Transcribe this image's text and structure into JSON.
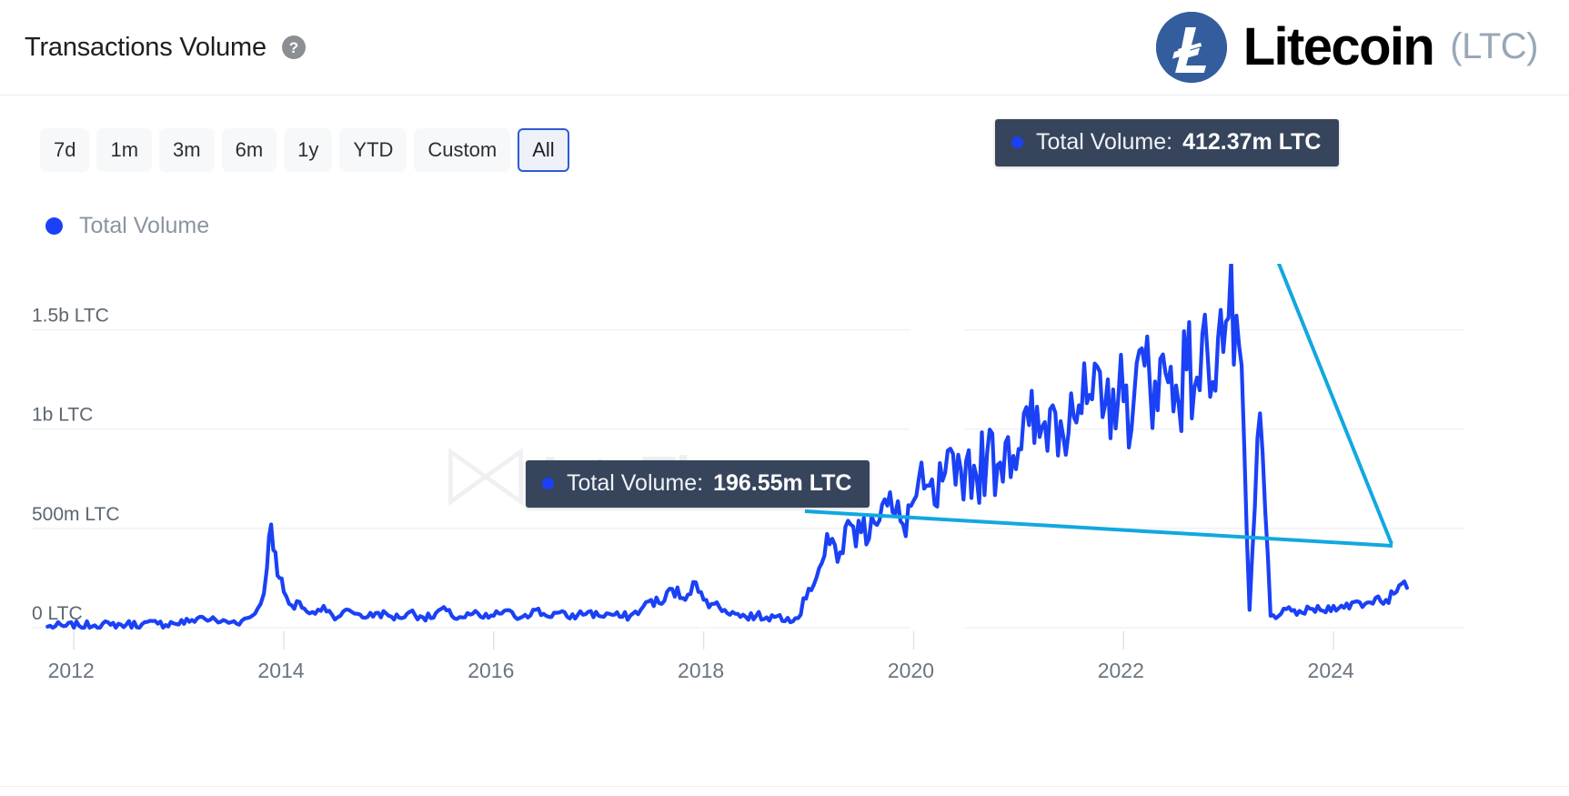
{
  "header": {
    "panel_title": "Transactions Volume",
    "help_icon": "question-mark-circle-icon",
    "coin_name": "Litecoin",
    "coin_ticker": "(LTC)",
    "coin_symbol": "Ł",
    "logo_color": "#345D9D"
  },
  "ranges": {
    "items": [
      {
        "label": "7d",
        "active": false
      },
      {
        "label": "1m",
        "active": false
      },
      {
        "label": "3m",
        "active": false
      },
      {
        "label": "6m",
        "active": false
      },
      {
        "label": "1y",
        "active": false
      },
      {
        "label": "YTD",
        "active": false
      },
      {
        "label": "Custom",
        "active": false
      },
      {
        "label": "All",
        "active": true
      }
    ],
    "selected": "All",
    "active_border_color": "#2D5BD6"
  },
  "legend": {
    "items": [
      {
        "label": "Total Volume",
        "color": "#1A41F5"
      }
    ]
  },
  "tooltips": [
    {
      "id": "tooltip-high",
      "label": "Total Volume:",
      "value": "412.37m LTC",
      "dot_color": "#1A41F5",
      "background": "#36455C"
    },
    {
      "id": "tooltip-mid",
      "label": "Total Volume:",
      "value": "196.55m LTC",
      "dot_color": "#1A41F5",
      "background": "#36455C"
    }
  ],
  "watermark": {
    "text": "IntoThe",
    "icon": "intotheblock-logo-icon"
  },
  "chart_data": {
    "type": "line",
    "title": "Transactions Volume",
    "xlabel": "",
    "ylabel": "LTC",
    "series_name": "Total Volume",
    "series_color": "#1A41F5",
    "grid": true,
    "legend_position": "top-left",
    "xlim": [
      2011.6,
      2024.9
    ],
    "ylim": [
      0,
      1750000000
    ],
    "ytick_values": [
      0,
      500000000,
      1000000000,
      1500000000
    ],
    "ytick_labels": [
      "0 LTC",
      "500m LTC",
      "1b LTC",
      "1.5b LTC"
    ],
    "xtick_values": [
      2012,
      2014,
      2016,
      2018,
      2020,
      2022,
      2024
    ],
    "xtick_labels": [
      "2012",
      "2014",
      "2016",
      "2018",
      "2020",
      "2022",
      "2024"
    ],
    "annotations": [
      {
        "label": "Total Volume",
        "value": 412370000,
        "value_label": "412.37m LTC",
        "x_approx": 2022.9
      },
      {
        "label": "Total Volume",
        "value": 196550000,
        "value_label": "196.55m LTC",
        "x_approx": 2018.95
      }
    ],
    "x": [
      2011.75,
      2011.9,
      2012.05,
      2012.2,
      2012.35,
      2012.5,
      2012.65,
      2012.8,
      2012.95,
      2013.1,
      2013.2,
      2013.3,
      2013.4,
      2013.5,
      2013.6,
      2013.7,
      2013.78,
      2013.84,
      2013.88,
      2013.92,
      2013.96,
      2014.0,
      2014.05,
      2014.1,
      2014.15,
      2014.22,
      2014.3,
      2014.38,
      2014.46,
      2014.54,
      2014.62,
      2014.7,
      2014.8,
      2014.9,
      2015.0,
      2015.1,
      2015.2,
      2015.3,
      2015.4,
      2015.5,
      2015.6,
      2015.7,
      2015.8,
      2015.9,
      2016.0,
      2016.1,
      2016.2,
      2016.3,
      2016.4,
      2016.5,
      2016.6,
      2016.7,
      2016.8,
      2016.9,
      2017.0,
      2017.1,
      2017.2,
      2017.3,
      2017.4,
      2017.5,
      2017.6,
      2017.7,
      2017.8,
      2017.9,
      2017.95,
      2018.0,
      2018.1,
      2018.2,
      2018.3,
      2018.4,
      2018.5,
      2018.6,
      2018.7,
      2018.8,
      2018.9,
      2019.0,
      2019.1,
      2019.2,
      2019.3,
      2019.4,
      2019.5,
      2019.6,
      2019.7,
      2019.8,
      2019.9,
      2020.0,
      2020.1,
      2020.2,
      2020.3,
      2020.4,
      2020.5,
      2020.6,
      2020.7,
      2020.8,
      2020.9,
      2021.0,
      2021.1,
      2021.2,
      2021.3,
      2021.4,
      2021.5,
      2021.6,
      2021.7,
      2021.8,
      2021.9,
      2022.0,
      2022.1,
      2022.2,
      2022.3,
      2022.4,
      2022.5,
      2022.6,
      2022.7,
      2022.8,
      2022.9,
      2023.0,
      2023.1,
      2023.2,
      2023.3,
      2023.4,
      2023.5,
      2023.6,
      2023.7,
      2023.8,
      2023.9,
      2024.0,
      2024.1,
      2024.2,
      2024.3,
      2024.4,
      2024.5,
      2024.6,
      2024.7
    ],
    "values": [
      5000000,
      8000000,
      10000000,
      12000000,
      14000000,
      16000000,
      18000000,
      20000000,
      22000000,
      30000000,
      55000000,
      40000000,
      30000000,
      28000000,
      35000000,
      60000000,
      120000000,
      300000000,
      520000000,
      380000000,
      250000000,
      180000000,
      120000000,
      95000000,
      130000000,
      80000000,
      70000000,
      110000000,
      65000000,
      60000000,
      90000000,
      70000000,
      55000000,
      75000000,
      60000000,
      50000000,
      80000000,
      58000000,
      48000000,
      95000000,
      60000000,
      52000000,
      70000000,
      50000000,
      60000000,
      85000000,
      55000000,
      65000000,
      90000000,
      60000000,
      75000000,
      55000000,
      65000000,
      80000000,
      60000000,
      70000000,
      55000000,
      60000000,
      90000000,
      140000000,
      120000000,
      195000000,
      150000000,
      230000000,
      180000000,
      140000000,
      120000000,
      90000000,
      70000000,
      55000000,
      60000000,
      52000000,
      58000000,
      50000000,
      48000000,
      196550000,
      300000000,
      420000000,
      380000000,
      520000000,
      480000000,
      560000000,
      620000000,
      580000000,
      520000000,
      640000000,
      700000000,
      620000000,
      780000000,
      720000000,
      840000000,
      760000000,
      880000000,
      820000000,
      960000000,
      900000000,
      1020000000,
      960000000,
      1100000000,
      1040000000,
      1180000000,
      1080000000,
      1150000000,
      1060000000,
      1200000000,
      1140000000,
      1160000000,
      1320000000,
      1240000000,
      1280000000,
      1220000000,
      1300000000,
      1260000000,
      1380000000,
      1460000000,
      1560000000,
      1420000000,
      90000000,
      1080000000,
      60000000,
      70000000,
      85000000,
      75000000,
      95000000,
      85000000,
      110000000,
      100000000,
      130000000,
      120000000,
      150000000,
      140000000,
      180000000,
      200000000
    ]
  }
}
